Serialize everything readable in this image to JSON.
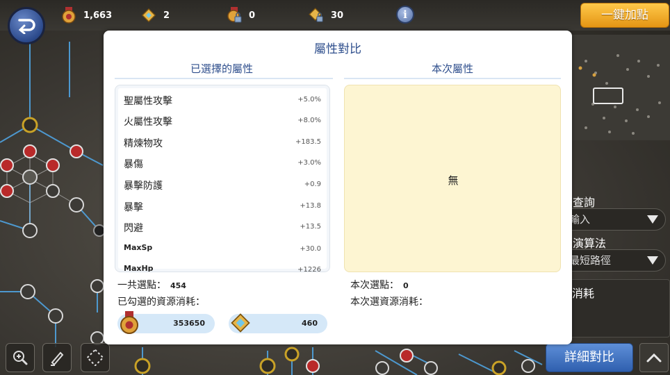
{
  "topbar": {
    "resources": [
      {
        "icon": "medal-icon",
        "value": "1,663"
      },
      {
        "icon": "crystal-icon",
        "value": "2"
      },
      {
        "icon": "locked-medal-icon",
        "value": "0"
      },
      {
        "icon": "locked-crystal-icon",
        "value": "30"
      }
    ],
    "info_label": "i",
    "auto_assign_label": "一鍵加點"
  },
  "side_panel": {
    "query_label": "查詢",
    "input_placeholder": "輸入",
    "algorithm_label": "演算法",
    "algorithm_value": "最短路徑",
    "cost_label": "消耗",
    "detail_compare_label": "詳細對比"
  },
  "modal": {
    "title": "屬性對比",
    "selected_title": "已選擇的屬性",
    "current_title": "本次屬性",
    "attributes": [
      {
        "name": "聖屬性攻擊",
        "value": "+5.0%"
      },
      {
        "name": "火屬性攻擊",
        "value": "+8.0%"
      },
      {
        "name": "精煉物攻",
        "value": "+183.5"
      },
      {
        "name": "暴傷",
        "value": "+3.0%"
      },
      {
        "name": "暴擊防護",
        "value": "+0.9"
      },
      {
        "name": "暴擊",
        "value": "+13.8"
      },
      {
        "name": "閃避",
        "value": "+13.5"
      },
      {
        "name": "MaxSp",
        "value": "+30.0"
      },
      {
        "name": "MaxHp",
        "value": "+1226"
      }
    ],
    "current_empty_text": "無",
    "total_points_label": "一共選點：",
    "total_points_value": "454",
    "selected_cost_label": "已勾選的資源消耗：",
    "selected_cost_medal": "353650",
    "selected_cost_crystal": "460",
    "current_points_label": "本次選點：",
    "current_points_value": "0",
    "current_cost_label": "本次選資源消耗："
  },
  "colors": {
    "title_blue": "#2f4f8d",
    "auto_button": "#f1ae2b",
    "detail_button": "#3f70bf",
    "current_box": "#fdf5d2",
    "cost_pill": "#d5e8f8"
  }
}
